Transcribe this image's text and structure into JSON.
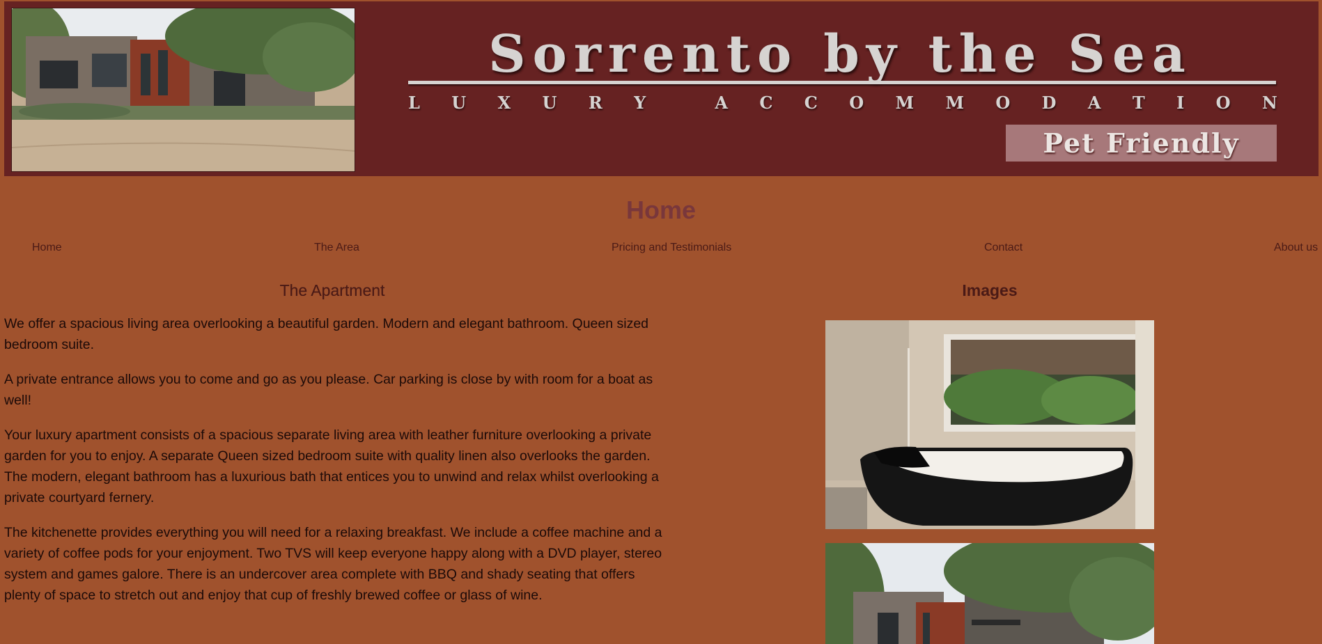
{
  "banner": {
    "title": "Sorrento by the Sea",
    "subtitle_letters": [
      "L",
      "U",
      "X",
      "U",
      "R",
      "Y",
      " ",
      "A",
      "C",
      "C",
      "O",
      "M",
      "M",
      "O",
      "D",
      "A",
      "T",
      "I",
      "O",
      "N"
    ],
    "badge": "Pet Friendly",
    "photo": "house-exterior-photo"
  },
  "page": {
    "heading": "Home"
  },
  "nav": {
    "items": [
      {
        "label": "Home"
      },
      {
        "label": "The Area"
      },
      {
        "label": "Pricing and Testimonials"
      },
      {
        "label": "Contact"
      },
      {
        "label": "About us"
      }
    ]
  },
  "apartment": {
    "heading": "The Apartment",
    "paragraphs": [
      "We offer a spacious living area overlooking a beautiful garden. Modern and elegant bathroom. Queen sized bedroom suite.",
      "A private entrance allows you to come and go as you please. Car parking is close by with room for a boat as well!",
      "Your luxury apartment consists of a spacious separate living area with leather furniture overlooking a private garden for you to enjoy. A separate Queen sized bedroom suite with quality linen also overlooks the garden. The modern, elegant bathroom has a luxurious bath that entices you to unwind and relax whilst overlooking a private courtyard fernery.",
      "The kitchenette provides everything you will need for a relaxing breakfast. We include a coffee machine and a variety of coffee pods for your enjoyment. Two TVS will keep everyone happy along with a DVD player, stereo system and games galore. There is an undercover area complete with BBQ and shady seating that offers plenty of space to stretch out and enjoy that cup of freshly brewed coffee or glass of wine."
    ]
  },
  "images": {
    "heading": "Images",
    "photos": [
      "bathroom-bath-photo",
      "house-exterior-photo"
    ]
  },
  "colors": {
    "page_bg": "#a0522d",
    "banner_bg": "#662222",
    "heading": "#79373b",
    "nav_text": "#4a1a16",
    "body_text": "#1c0a08"
  }
}
